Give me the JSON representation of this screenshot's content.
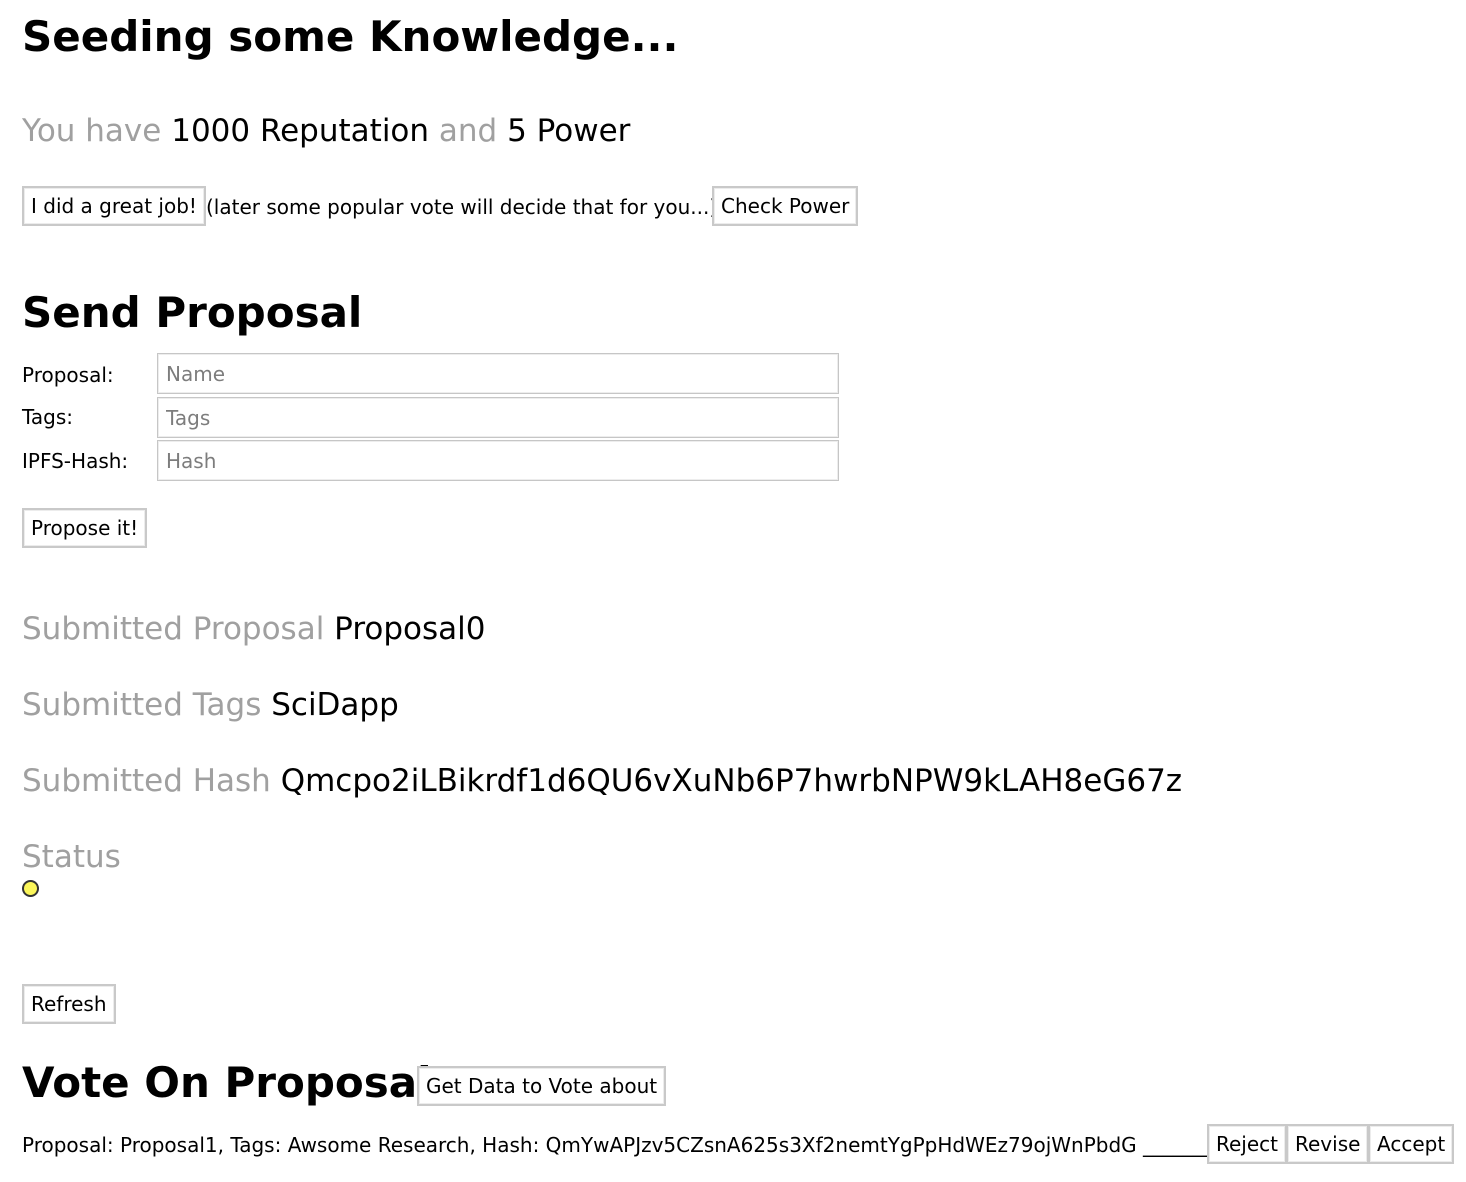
{
  "header": {
    "title": "Seeding some Knowledge...",
    "you_have": "You have",
    "reputation": "1000 Reputation",
    "and": "and",
    "power": "5 Power"
  },
  "actions": {
    "great_job_label": "I did a great job!",
    "note": "(later some popular vote will decide that for you...)",
    "check_power_label": "Check Power"
  },
  "send_proposal": {
    "heading": "Send Proposal",
    "fields": [
      {
        "label": "Proposal:",
        "placeholder": "Name",
        "value": ""
      },
      {
        "label": "Tags:",
        "placeholder": "Tags",
        "value": ""
      },
      {
        "label": "IPFS-Hash:",
        "placeholder": "Hash",
        "value": ""
      }
    ],
    "submit_label": "Propose it!"
  },
  "submitted": {
    "proposal_label": "Submitted Proposal",
    "proposal_value": "Proposal0",
    "tags_label": "Submitted Tags",
    "tags_value": "SciDapp",
    "hash_label": "Submitted Hash",
    "hash_value": "Qmcpo2iLBikrdf1d6QU6vXuNb6P7hwrbNPW9kLAH8eG67z",
    "status_label": "Status",
    "status_color": "#fbf65a",
    "refresh_label": "Refresh"
  },
  "vote": {
    "heading": "Vote On Proposals",
    "get_data_label": "Get Data to Vote about",
    "item_text": "Proposal: Proposal1, Tags: Awsome Research, Hash: QmYwAPJzv5CZsnA625s3Xf2nemtYgPpHdWEz79ojWnPbdG _______",
    "reject_label": "Reject",
    "revise_label": "Revise",
    "accept_label": "Accept"
  }
}
